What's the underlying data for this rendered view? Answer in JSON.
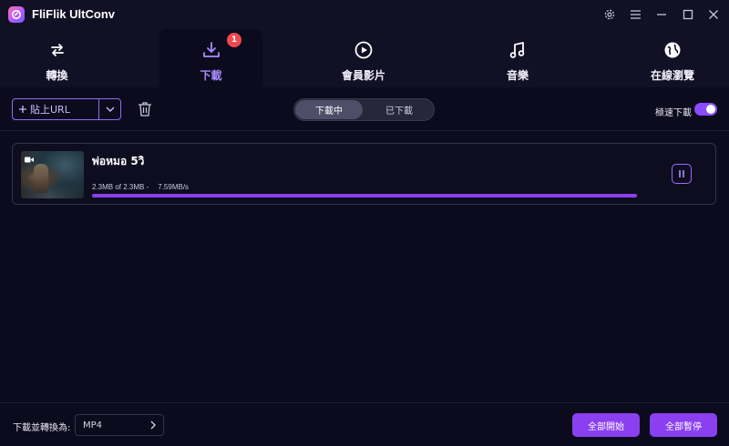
{
  "app": {
    "title": "FliFlik UltConv",
    "brand_color": "#8a3ff0"
  },
  "window_controls": [
    {
      "name": "settings",
      "icon": "gear-icon"
    },
    {
      "name": "menu",
      "icon": "hamburger-icon"
    },
    {
      "name": "minimize",
      "icon": "minimize-icon"
    },
    {
      "name": "maximize",
      "icon": "maximize-icon"
    },
    {
      "name": "close",
      "icon": "close-icon"
    }
  ],
  "tabs": [
    {
      "label": "轉換",
      "icon": "convert-arrows-icon",
      "active": false
    },
    {
      "label": "下載",
      "icon": "download-icon",
      "active": true,
      "badge": "1"
    },
    {
      "label": "會員影片",
      "icon": "play-circle-icon",
      "active": false
    },
    {
      "label": "音樂",
      "icon": "music-note-icon",
      "active": false
    },
    {
      "label": "在線瀏覽",
      "icon": "globe-icon",
      "active": false
    }
  ],
  "toolbar": {
    "paste_label": "貼上URL",
    "segment": [
      "下載中",
      "已下載"
    ],
    "segment_active": 0,
    "turbo_label": "極速下載",
    "turbo_on": true
  },
  "downloads": [
    {
      "title": "พ่อหมอ 5วิ",
      "size_text": "2.3MB of 2.3MB -",
      "speed": "7.59MB/s",
      "progress": 1.0
    }
  ],
  "footer": {
    "convert_label": "下載並轉換為:",
    "format": "MP4",
    "start_all": "全部開始",
    "pause_all": "全部暫停"
  }
}
